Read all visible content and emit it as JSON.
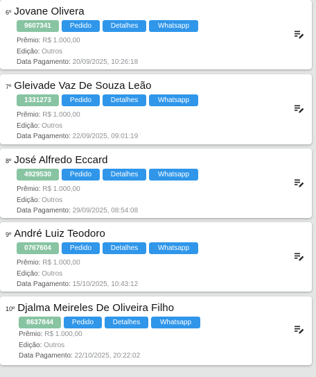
{
  "labels": {
    "premio": "Prêmio:",
    "edicao": "Edição:",
    "data_pagamento": "Data Pagamento:",
    "pedido": "Pedido",
    "detalhes": "Detalhes",
    "whatsapp": "Whatsapp"
  },
  "colors": {
    "badge": "#88c4a2",
    "button": "#2f96ea",
    "background": "#e4e6e5"
  },
  "winners": [
    {
      "position": "6º",
      "name": "Jovane Olivera",
      "code": "9607341",
      "premio": "R$ 1.000,00",
      "edicao": "Outros",
      "data_pagamento": "20/09/2025, 10:26:18"
    },
    {
      "position": "7º",
      "name": "Gleivade Vaz De Souza Leão",
      "code": "1331273",
      "premio": "R$ 1.000,00",
      "edicao": "Outros",
      "data_pagamento": "22/09/2025, 09:01:19"
    },
    {
      "position": "8º",
      "name": "José Alfredo Eccard",
      "code": "4929530",
      "premio": "R$ 1.000,00",
      "edicao": "Outros",
      "data_pagamento": "29/09/2025, 08:54:08"
    },
    {
      "position": "9º",
      "name": "André Luiz Teodoro",
      "code": "0767604",
      "premio": "R$ 1.000,00",
      "edicao": "Outros",
      "data_pagamento": "15/10/2025, 10:43:12"
    },
    {
      "position": "10º",
      "name": "Djalma Meireles De Oliveira Filho",
      "code": "8637844",
      "premio": "R$ 1.000,00",
      "edicao": "Outros",
      "data_pagamento": "22/10/2025, 20:22:02"
    }
  ]
}
